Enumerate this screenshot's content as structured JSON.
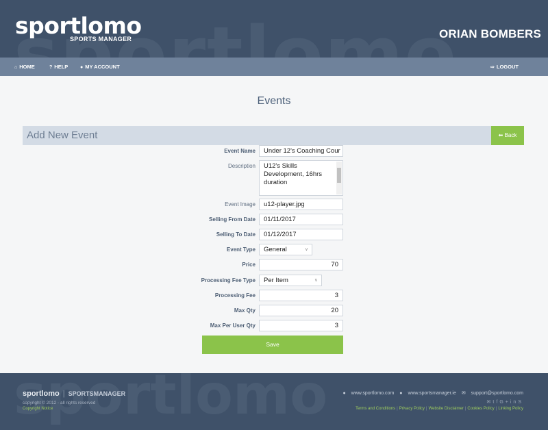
{
  "header": {
    "logo_text": "sportlomo",
    "logo_subtitle": "SPORTS MANAGER",
    "team_name": "ORIAN BOMBERS"
  },
  "nav": {
    "home": "HOME",
    "help": "HELP",
    "my_account": "MY ACCOUNT",
    "logout": "LOGOUT"
  },
  "page": {
    "title": "Events",
    "section_title": "Add New Event",
    "back_label": "Back"
  },
  "form": {
    "event_name": {
      "label": "Event Name",
      "value": "Under 12's Coaching Cour"
    },
    "description": {
      "label": "Description",
      "value": "U12's Skills Development, 16hrs duration"
    },
    "event_image": {
      "label": "Event Image",
      "value": "u12-player.jpg"
    },
    "selling_from": {
      "label": "Selling From Date",
      "value": "01/11/2017"
    },
    "selling_to": {
      "label": "Selling To Date",
      "value": "01/12/2017"
    },
    "event_type": {
      "label": "Event Type",
      "value": "General"
    },
    "price": {
      "label": "Price",
      "value": "70"
    },
    "processing_fee_type": {
      "label": "Processing Fee Type",
      "value": "Per Item"
    },
    "processing_fee": {
      "label": "Processing Fee",
      "value": "3"
    },
    "max_qty": {
      "label": "Max Qty",
      "value": "20"
    },
    "max_per_user_qty": {
      "label": "Max Per User Qty",
      "value": "3"
    },
    "save_label": "Save"
  },
  "footer": {
    "brand": "sportlomo",
    "brand_secondary": "SPORTSMANAGER",
    "copyright": "copyright © 2012 - all rights reserved",
    "copyright_notice": "Copyright Notice",
    "web1": "www.sportlomo.com",
    "web2": "www.sportsmanager.ie",
    "email": "support@sportlomo.com",
    "links": {
      "terms": "Terms and Conditions",
      "privacy": "Privacy Policy",
      "disclaimer": "Website Disclaimer",
      "cookies": "Cookies Policy",
      "linking": "Linking Policy"
    }
  },
  "colors": {
    "header_bg": "#3f5169",
    "nav_bg": "#6f829b",
    "accent_green": "#8bc34a",
    "section_bar": "#d3dbe5"
  },
  "icons": [
    "home-icon",
    "help-icon",
    "user-icon",
    "logout-icon",
    "arrow-left-icon",
    "globe-icon",
    "mail-icon",
    "twitter-icon",
    "facebook-icon",
    "google-plus-icon",
    "linkedin-icon",
    "skype-icon"
  ]
}
